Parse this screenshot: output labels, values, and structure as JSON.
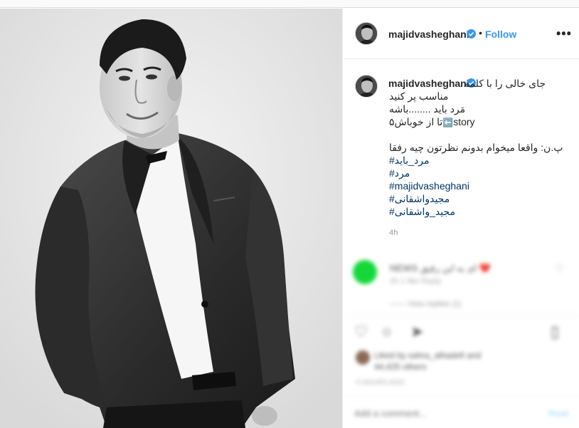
{
  "post": {
    "username": "majidvasheghani",
    "separator": "•",
    "follow_label": "Follow",
    "more_label": "•••"
  },
  "caption": {
    "username": "majidvasheghani",
    "lines": [
      "جای خالی را با کلمه",
      "مناسب پر کنید",
      "مَرد باید ........باشه",
      "تا از خوباش۵",
      "",
      "پ.ن: واقعا میخوام بدونم نظرتون چیه رفقا"
    ],
    "story_word": "story",
    "story_arrow": "⬅️",
    "hashtags": [
      "#مرد_باید",
      "#مرد",
      "#majidvasheghani",
      "#مجیدواشقانی",
      "#مجید_واشقانی"
    ],
    "time": "4h"
  },
  "blurred": {
    "comment_text": "NEWS ای به این رفیق ❤️",
    "comment_meta": "2h   1 like   Reply",
    "view_replies": "—— View replies (1)",
    "likes_line1": "Liked by sahra_alhadefi and",
    "likes_line2": "44,425 others",
    "date_text": "4 HOURS AGO",
    "add_comment_placeholder": "Add a comment...",
    "post_label": "Post"
  },
  "colors": {
    "link": "#3897f0",
    "hashtag": "#003569",
    "verified": "#3897f0",
    "timestamp": "#999999"
  }
}
